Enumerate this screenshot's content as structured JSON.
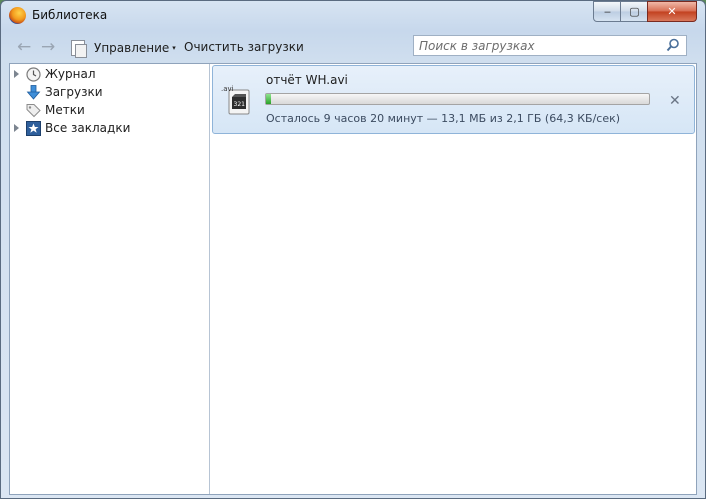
{
  "window": {
    "title": "Библиотека",
    "close_glyph": "✕",
    "minimize_glyph": "‒",
    "maximize_glyph": "▢"
  },
  "toolbar": {
    "back_icon": "back-arrow-icon",
    "forward_icon": "forward-arrow-icon",
    "organize_label": "Управление",
    "organize_chevron": "▾",
    "clear_label": "Очистить загрузки",
    "search_placeholder": "Поиск в загрузках"
  },
  "sidebar": {
    "items": [
      {
        "label": "Журнал",
        "icon": "clock-icon",
        "expandable": true
      },
      {
        "label": "Загрузки",
        "icon": "download-arrow-icon",
        "expandable": false
      },
      {
        "label": "Метки",
        "icon": "tag-icon",
        "expandable": false
      },
      {
        "label": "Все закладки",
        "icon": "star-bookmark-icon",
        "expandable": true
      }
    ]
  },
  "downloads": [
    {
      "file_icon_label": ".avi",
      "file_name": "отчёт WH.avi",
      "progress_fraction": 0.01,
      "status": "Осталось 9 часов 20 минут — 13,1 МБ из 2,1 ГБ (64,3 КБ/сек)",
      "cancel_glyph": "✕"
    }
  ],
  "colors": {
    "progress_fill": "#2aa32a",
    "selected_row": "#d6e6f6",
    "close_button": "#c2401f"
  }
}
